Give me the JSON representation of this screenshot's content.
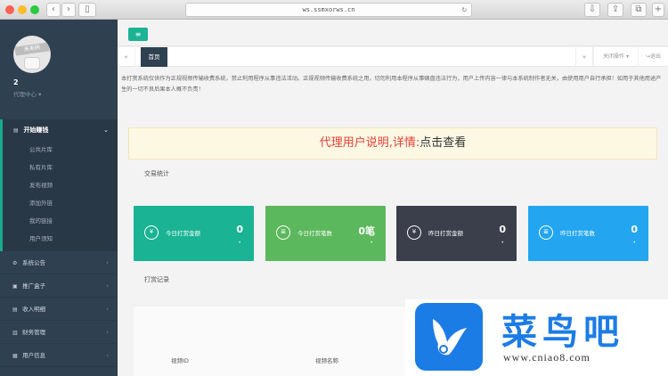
{
  "browser": {
    "url": "ws.ssmxorws.cn",
    "back": "‹",
    "forward": "›",
    "sidebar_toggle": "▯",
    "reload": "↻",
    "download": "⇩",
    "share": "⇪",
    "tabs": "⧉",
    "add": "+"
  },
  "sidebar": {
    "avatar_text": "未来网",
    "username": "2",
    "role": "代理中心 ▾",
    "groups": [
      {
        "label": "开始赚钱",
        "caret": "⌄",
        "items": [
          "公共片库",
          "私有片库",
          "发布视频",
          "添加外链",
          "我的链接",
          "用户须知"
        ]
      }
    ],
    "items": [
      {
        "label": "系统公告",
        "icon": "⚙",
        "caret": "‹"
      },
      {
        "label": "推广盒子",
        "icon": "▣",
        "caret": "‹"
      },
      {
        "label": "收入明细",
        "icon": "▤",
        "caret": "‹"
      },
      {
        "label": "财务管理",
        "icon": "▥",
        "caret": "‹"
      },
      {
        "label": "用户信息",
        "icon": "▦",
        "caret": "‹"
      }
    ]
  },
  "topbar": {
    "menu_toggle": "≡"
  },
  "tabs": {
    "left_arrow": "«",
    "home": "首页",
    "right_arrow": "»",
    "tab_ops": "关闭操作 ▾",
    "exit": "↪退出"
  },
  "content": {
    "notice": "本打赏系统仅供作为正规视频传输收费系统，禁止利用程序从事违法活动。正规视频传输收费系统之用，切勿利用本程序从事赌盘违法行为，用户上传内容一律与本系统制作者无关，由使用用户自行承担！如用于其他用途产生的一切不良后果本人概不负责！",
    "banner_main": "代理用户说明,详情:",
    "banner_link": "点击查看",
    "stats_title": "交易统计",
    "records_title": "打赏记录",
    "stats": [
      {
        "label": "今日打赏金额",
        "value": "0",
        "icon": "¥",
        "color": "#1ab394"
      },
      {
        "label": "今日打赏笔数",
        "value": "0笔",
        "icon": "≣",
        "color": "#5cb85c"
      },
      {
        "label": "昨日打赏金额",
        "value": "0",
        "icon": "¥",
        "color": "#3a3f4b"
      },
      {
        "label": "昨日打赏笔数",
        "value": "0",
        "icon": "≣",
        "color": "#23a6ef"
      }
    ],
    "stat_dot": "•",
    "table_headers": [
      "视频ID",
      "视频名称"
    ]
  },
  "watermark": {
    "text_cn": "菜鸟吧",
    "text_url": "www.cniao8.com"
  }
}
